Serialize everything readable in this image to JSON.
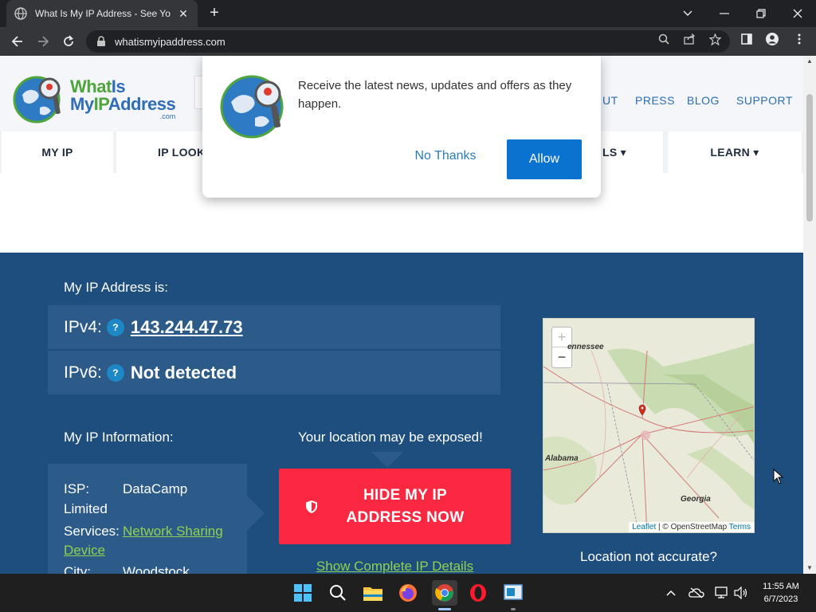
{
  "browser": {
    "tab_title": "What Is My IP Address - See Your",
    "url": "whatismyipaddress.com"
  },
  "site": {
    "logo": {
      "line1_a": "What",
      "line1_b": "Is",
      "line2_a": "My",
      "line2_b": "IP",
      "line2_c": "Address",
      "line3": ".com"
    },
    "top_links": [
      "UT",
      "PRESS",
      "BLOG",
      "SUPPORT"
    ],
    "nav": [
      "MY IP",
      "IP LOOK",
      "LS ▾",
      "LEARN ▾"
    ]
  },
  "popup": {
    "message": "Receive the latest news, updates and offers as they happen.",
    "no_label": "No Thanks",
    "allow_label": "Allow"
  },
  "hero": {
    "ip_heading": "My IP Address is:",
    "ipv4_label": "IPv4:",
    "ipv4_value": "143.244.47.73",
    "ipv6_label": "IPv6:",
    "ipv6_value": "Not detected",
    "qmark": "?",
    "info_heading": "My IP Information:",
    "exposed": "Your location may be exposed!",
    "isp_key": "ISP:",
    "isp_value": "DataCamp",
    "isp_value2": "Limited",
    "services_key": "Services:",
    "services_value": "Network Sharing",
    "services_value2": "Device",
    "city_key": "City:",
    "city_value": "Woodstock",
    "hide_button": "HIDE MY IP ADDRESS NOW",
    "details_link": "Show Complete IP Details",
    "location_note": "Location not accurate?"
  },
  "map": {
    "zoom_in": "+",
    "zoom_out": "−",
    "labels": {
      "tennessee": "ennessee",
      "alabama": "Alabama",
      "georgia": "Georgia"
    },
    "attribution_leaflet": "Leaflet",
    "attribution_sep": " | © OpenStreetMap ",
    "attribution_terms": "Terms"
  },
  "taskbar": {
    "time": "11:55 AM",
    "date": "6/7/2023"
  },
  "colors": {
    "hero_bg": "#1e4e7d",
    "hide_button": "#fa2841",
    "allow_button": "#0a72cf",
    "link_green": "#8fd14f"
  }
}
